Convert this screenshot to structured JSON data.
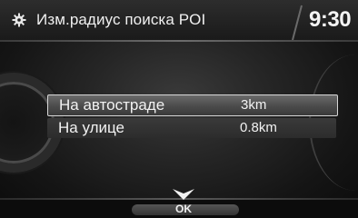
{
  "header": {
    "icon": "gear-icon",
    "title": "Изм.радиус поиска POI",
    "clock": "9:30"
  },
  "settings": {
    "rows": [
      {
        "label": "На автостраде",
        "value": "3km",
        "selected": true
      },
      {
        "label": "На улице",
        "value": "0.8km",
        "selected": false
      }
    ]
  },
  "footer": {
    "ok_label": "OK",
    "arrow_icon": "down-arrow-icon"
  },
  "colors": {
    "background": "#151515",
    "selection_border": "#d6d6d6",
    "text": "#f2f2f2"
  }
}
